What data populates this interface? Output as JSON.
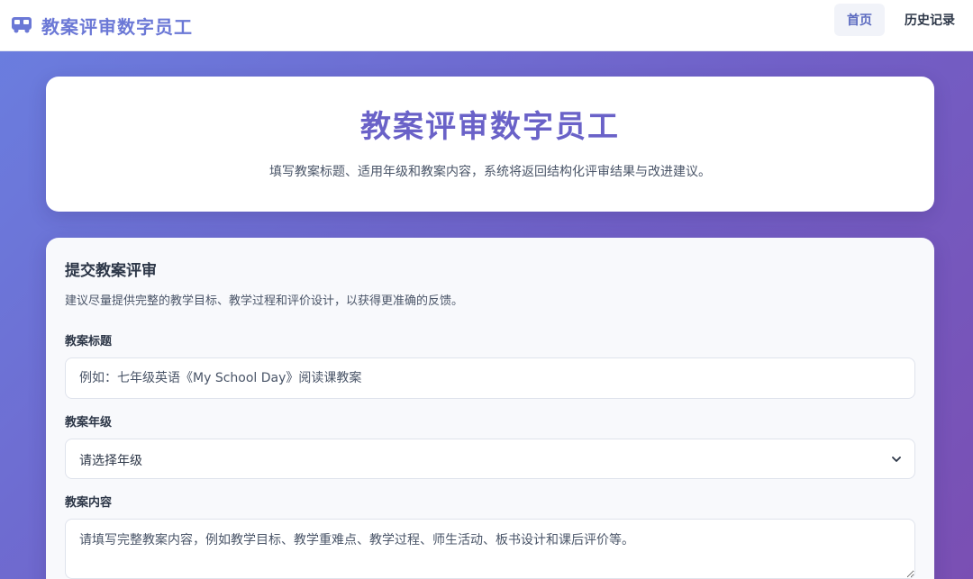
{
  "app": {
    "brand_name": "教案评审数字员工",
    "brand_icon": "bus-icon",
    "accent_color": "#6b78d6"
  },
  "nav": {
    "items": [
      {
        "label": "首页",
        "active": true
      },
      {
        "label": "历史记录",
        "active": false
      }
    ]
  },
  "hero": {
    "title": "教案评审数字员工",
    "subtitle": "填写教案标题、适用年级和教案内容，系统将返回结构化评审结果与改进建议。"
  },
  "form": {
    "title": "提交教案评审",
    "description": "建议尽量提供完整的教学目标、教学过程和评价设计，以获得更准确的反馈。",
    "title_field": {
      "label": "教案标题",
      "value": "",
      "placeholder": "例如：七年级英语《My School Day》阅读课教案"
    },
    "grade_field": {
      "label": "教案年级",
      "selected": "请选择年级"
    },
    "content_field": {
      "label": "教案内容",
      "value": "",
      "placeholder": "请填写完整教案内容，例如教学目标、教学重难点、教学过程、师生活动、板书设计和课后评价等。"
    }
  }
}
